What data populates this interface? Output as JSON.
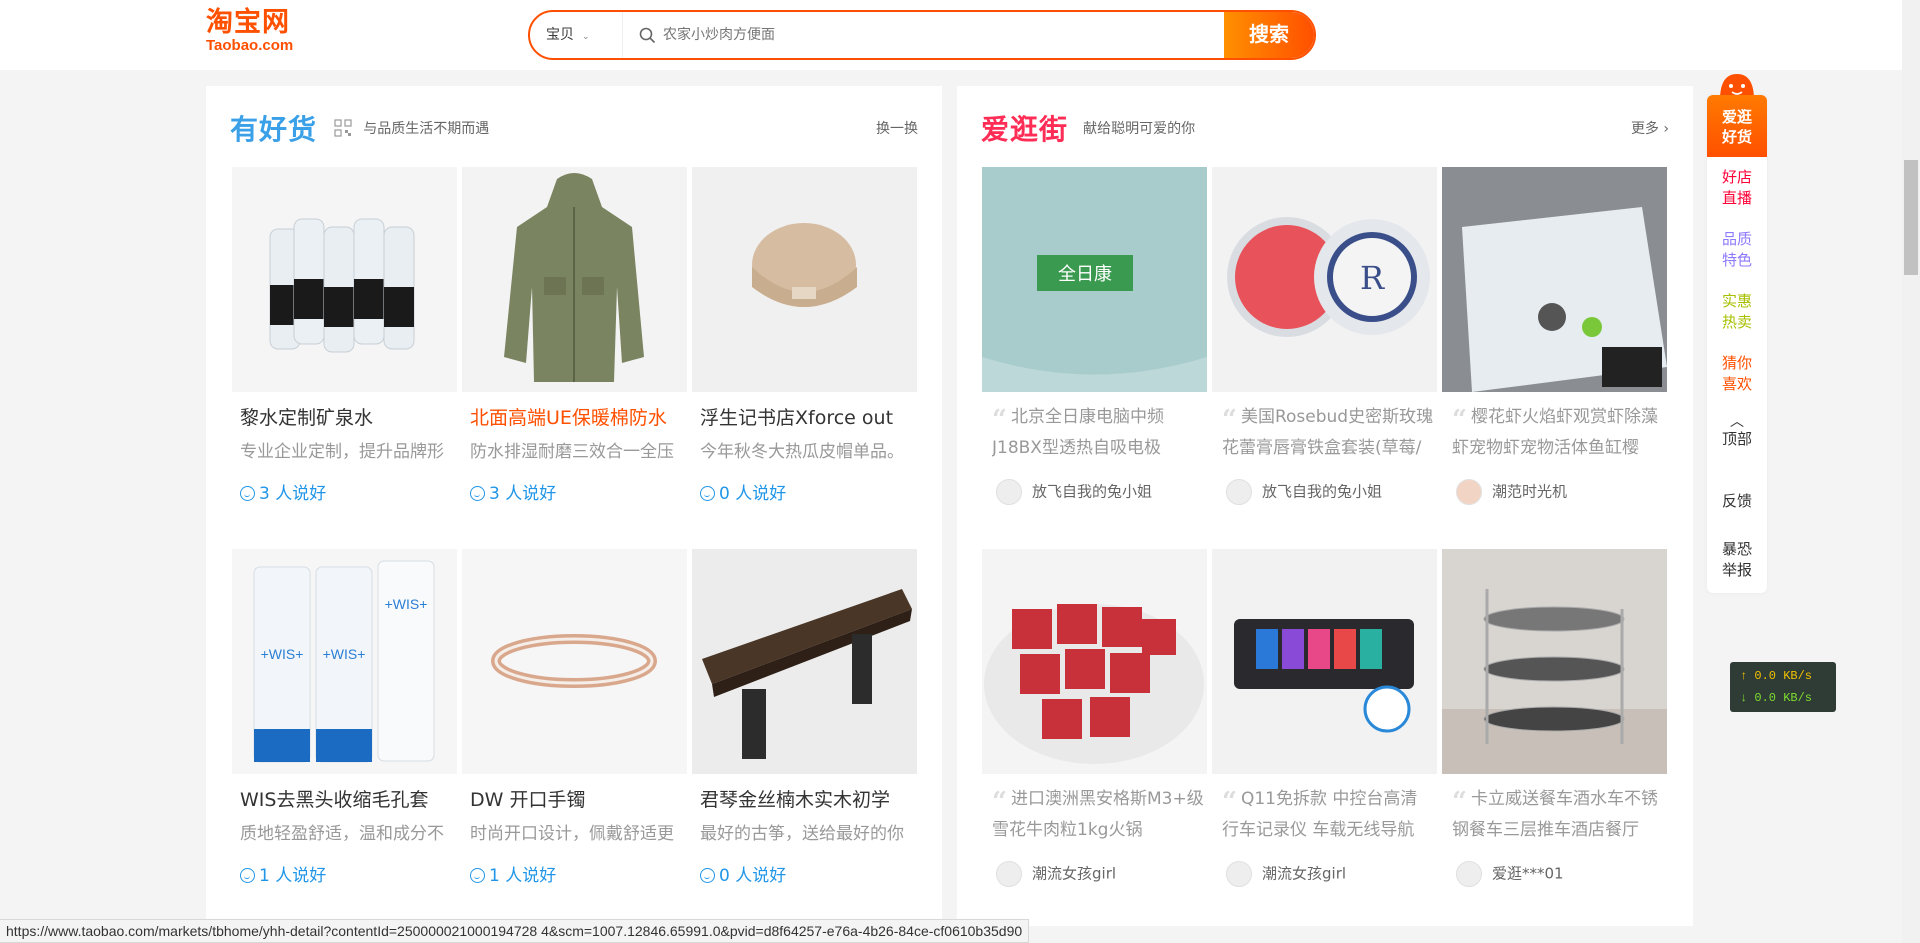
{
  "header": {
    "logo_cn": "淘宝网",
    "logo_en": "Taobao.com",
    "search_category": "宝贝",
    "search_placeholder": "农家小炒肉方便面",
    "search_button": "搜索"
  },
  "left_panel": {
    "title": "有好货",
    "subtitle": "与品质生活不期而遇",
    "more": "换一换",
    "items": [
      {
        "title": "黎水定制矿泉水",
        "desc": "专业企业定制，提升品牌形",
        "likes": "3 人说好",
        "highlight": false
      },
      {
        "title": "北面高端UE保暖棉防水",
        "desc": "防水排湿耐磨三效合一全压",
        "likes": "3 人说好",
        "highlight": true
      },
      {
        "title": "浮生记书店Xforce out",
        "desc": "今年秋冬大热瓜皮帽单品。",
        "likes": "0 人说好",
        "highlight": false
      },
      {
        "title": "WIS去黑头收缩毛孔套",
        "desc": "质地轻盈舒适，温和成分不",
        "likes": "1 人说好",
        "highlight": false
      },
      {
        "title": "DW 开口手镯",
        "desc": "时尚开口设计，佩戴舒适更",
        "likes": "1 人说好",
        "highlight": false
      },
      {
        "title": "君琴金丝楠木实木初学",
        "desc": "最好的古筝，送给最好的你",
        "likes": "0 人说好",
        "highlight": false
      }
    ]
  },
  "right_panel": {
    "title": "爱逛街",
    "subtitle": "献给聪明可爱的你",
    "more": "更多 ›",
    "items": [
      {
        "text": "北京全日康电脑中频J18BX型透热自吸电极",
        "user": "放飞自我的兔小姐"
      },
      {
        "text": "美国Rosebud史密斯玫瑰花蕾膏唇膏铁盒套装(草莓/",
        "user": "放飞自我的兔小姐"
      },
      {
        "text": "樱花虾火焰虾观赏虾除藻虾宠物虾宠物活体鱼缸樱",
        "user": "潮范时光机"
      },
      {
        "text": "进口澳洲黑安格斯M3+级雪花牛肉粒1kg火锅",
        "user": "潮流女孩girl"
      },
      {
        "text": "Q11免拆款 中控台高清行车记录仪 车载无线导航",
        "user": "潮流女孩girl"
      },
      {
        "text": "卡立威送餐车酒水车不锈钢餐车三层推车酒店餐厅",
        "user": "爱逛***01"
      }
    ]
  },
  "sidebar": {
    "top": "爱逛好货",
    "items": [
      {
        "label": "好店直播",
        "color": "#ff0036"
      },
      {
        "label": "品质特色",
        "color": "#8d7afb"
      },
      {
        "label": "实惠热卖",
        "color": "#a8c001"
      },
      {
        "label": "猜你喜欢",
        "color": "#ff5000"
      },
      {
        "label": "顶部",
        "color": "#333333"
      },
      {
        "label": "反馈",
        "color": "#333333"
      },
      {
        "label": "暴恐举报",
        "color": "#333333"
      }
    ]
  },
  "netspeed": {
    "up": "↑ 0.0 KB/s",
    "down": "↓ 0.0 KB/s"
  },
  "status_url": "https://www.taobao.com/markets/tbhome/yhh-detail?contentId=250000021000194728 4&scm=1007.12846.65991.0&pvid=d8f64257-e76a-4b26-84ce-cf0610b35d90"
}
